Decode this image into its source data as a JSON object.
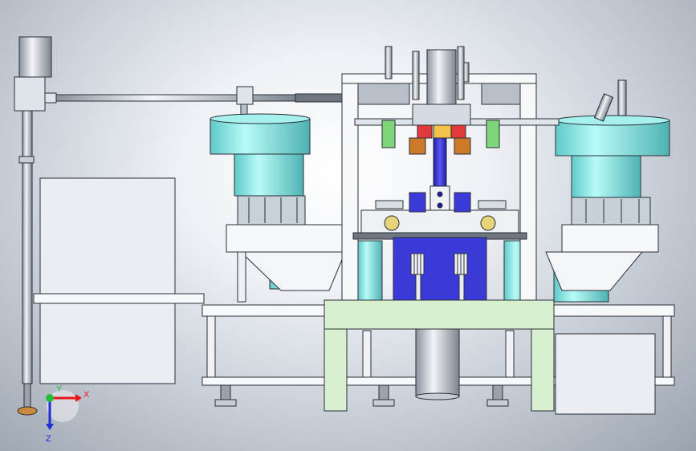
{
  "view": {
    "triad": {
      "x_label": "X",
      "y_label": "Y",
      "z_label": "Z",
      "colors": {
        "x": "#e8161b",
        "y": "#1fbf3a",
        "z": "#1b2fd6"
      }
    }
  },
  "palette": {
    "bowl_cyan": "#7fe6e4",
    "frame_white": "#f6f8fa",
    "carriage_blue": "#3a3ad8",
    "base_green": "#d8f0d0",
    "cabinet_grey": "#e9edf2",
    "outline": "#2a2f36"
  }
}
